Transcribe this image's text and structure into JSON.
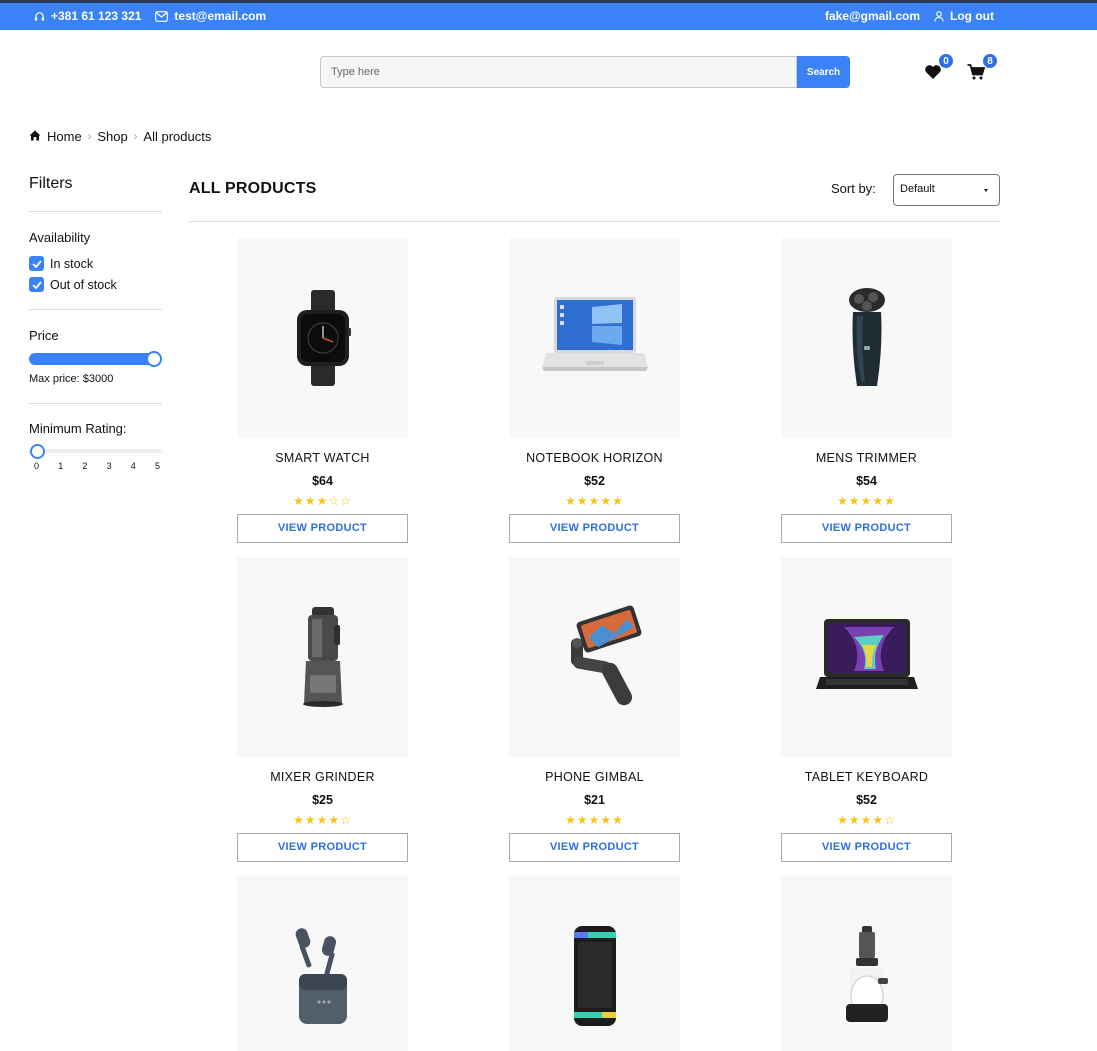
{
  "topbar": {
    "phone": "+381 61 123 321",
    "email": "test@email.com",
    "user_email": "fake@gmail.com",
    "logout_label": "Log out"
  },
  "search": {
    "placeholder": "Type here",
    "button_label": "Search"
  },
  "header": {
    "wishlist_count": "0",
    "cart_count": "8"
  },
  "breadcrumb": {
    "items": [
      "Home",
      "Shop",
      "All products"
    ]
  },
  "sidebar": {
    "title": "Filters",
    "availability": {
      "title": "Availability",
      "options": [
        {
          "label": "In stock",
          "checked": true
        },
        {
          "label": "Out of stock",
          "checked": true
        }
      ]
    },
    "price": {
      "title": "Price",
      "max_label": "Max price: $3000",
      "value_fraction": 1.0
    },
    "rating": {
      "title": "Minimum Rating:",
      "ticks": [
        "0",
        "1",
        "2",
        "3",
        "4",
        "5"
      ],
      "value": 0
    }
  },
  "main": {
    "title": "ALL PRODUCTS",
    "sort_label": "Sort by:",
    "sort_value": "Default"
  },
  "products": [
    {
      "name": "SMART WATCH",
      "price": "$64",
      "rating": 3,
      "button": "VIEW PRODUCT",
      "image": "smartwatch"
    },
    {
      "name": "NOTEBOOK HORIZON",
      "price": "$52",
      "rating": 5,
      "button": "VIEW PRODUCT",
      "image": "laptop"
    },
    {
      "name": "MENS TRIMMER",
      "price": "$54",
      "rating": 5,
      "button": "VIEW PRODUCT",
      "image": "trimmer"
    },
    {
      "name": "MIXER GRINDER",
      "price": "$25",
      "rating": 4,
      "button": "VIEW PRODUCT",
      "image": "mixer"
    },
    {
      "name": "PHONE GIMBAL",
      "price": "$21",
      "rating": 5,
      "button": "VIEW PRODUCT",
      "image": "gimbal"
    },
    {
      "name": "TABLET KEYBOARD",
      "price": "$52",
      "rating": 4,
      "button": "VIEW PRODUCT",
      "image": "tablet"
    },
    {
      "name": "",
      "price": "",
      "rating": 0,
      "button": "",
      "image": "earbuds"
    },
    {
      "name": "",
      "price": "",
      "rating": 0,
      "button": "",
      "image": "speaker"
    },
    {
      "name": "",
      "price": "",
      "rating": 0,
      "button": "",
      "image": "juicer"
    }
  ],
  "colors": {
    "primary": "#3b82f6",
    "star": "#f5c518",
    "button_text": "#2f6fe0"
  }
}
